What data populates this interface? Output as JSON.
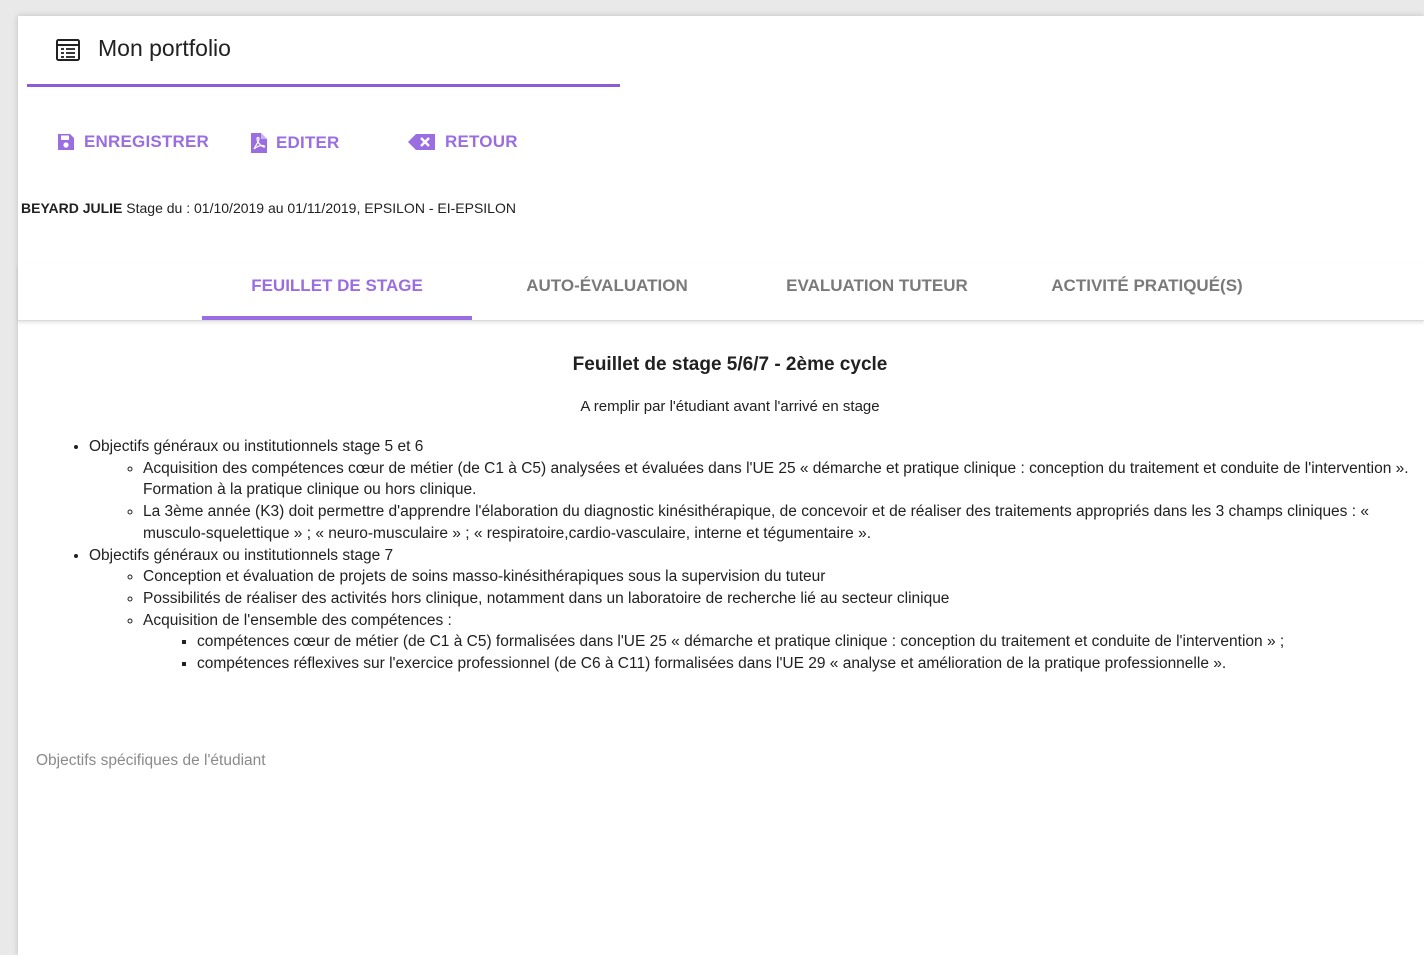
{
  "header": {
    "title": "Mon portfolio",
    "icon": "portfolio-icon"
  },
  "actions": {
    "save": "ENREGISTRER",
    "edit": "EDITER",
    "back": "RETOUR"
  },
  "info": {
    "student": "BEYARD JULIE",
    "details": "Stage du : 01/10/2019 au 01/11/2019, EPSILON - EI-EPSILON"
  },
  "tabs": [
    {
      "label": "FEUILLET DE STAGE",
      "active": true
    },
    {
      "label": "AUTO-ÉVALUATION",
      "active": false
    },
    {
      "label": "EVALUATION TUTEUR",
      "active": false
    },
    {
      "label": "ACTIVITÉ PRATIQUÉ(S)",
      "active": false
    }
  ],
  "sheet": {
    "title": "Feuillet de stage 5/6/7 - 2ème cycle",
    "subtitle": "A remplir par l'étudiant avant l'arrivé en stage",
    "objectives": [
      {
        "text": "Objectifs généraux ou institutionnels stage 5 et 6",
        "items": [
          {
            "text": "Acquisition des compétences cœur de métier (de C1 à C5) analysées et évaluées dans l'UE 25 « démarche et pratique clinique : conception du traitement et conduite de l'intervention ». Formation à la pratique clinique ou hors clinique."
          },
          {
            "text": "La 3ème année (K3) doit permettre d'apprendre l'élaboration du diagnostic kinésithérapique, de concevoir et de réaliser des traitements appropriés dans les 3 champs cliniques : « musculo-squelettique » ; « neuro-musculaire » ; « respiratoire,cardio-vasculaire, interne et tégumentaire »."
          }
        ]
      },
      {
        "text": "Objectifs généraux ou institutionnels stage 7",
        "items": [
          {
            "text": "Conception et évaluation de projets de soins masso-kinésithérapiques sous la supervision du tuteur"
          },
          {
            "text": "Possibilités de réaliser des activités hors clinique, notamment dans un laboratoire de recherche lié au secteur clinique"
          },
          {
            "text": "Acquisition de l'ensemble des compétences :",
            "items": [
              {
                "text": "compétences cœur de métier (de C1 à C5) formalisées dans l'UE 25 « démarche et pratique clinique : conception du traitement et conduite de l'intervention » ;"
              },
              {
                "text": "compétences réflexives sur l'exercice professionnel (de C6 à C11) formalisées dans l'UE 29 « analyse et amélioration de la pratique professionnelle »."
              }
            ]
          }
        ]
      }
    ],
    "specific_label": "Objectifs spécifiques de l'étudiant"
  },
  "colors": {
    "accent": "#9a6ee0",
    "underline": "#8c5bd6",
    "tab_inactive": "#7a7a7a"
  }
}
